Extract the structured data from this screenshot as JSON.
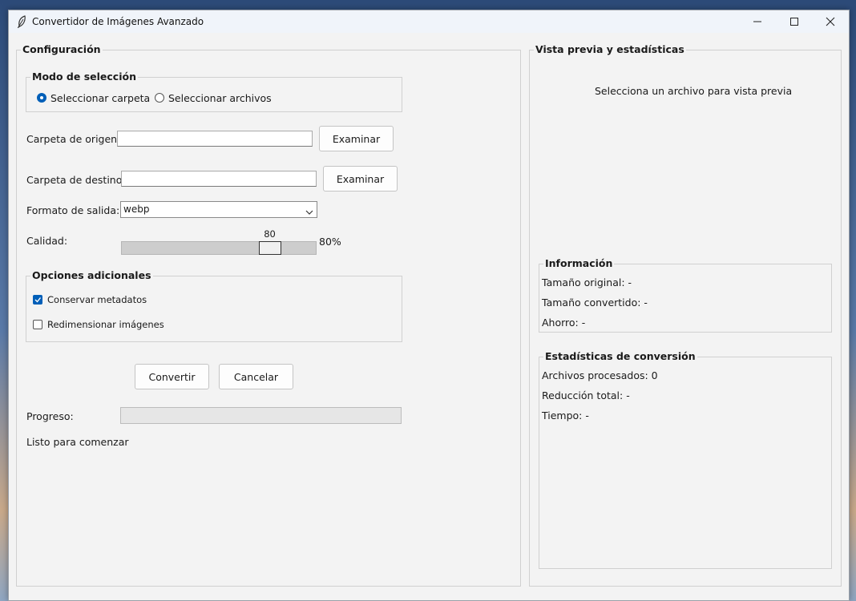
{
  "window": {
    "title": "Convertidor de Imágenes Avanzado",
    "icon": "feather-icon"
  },
  "config": {
    "frame_title": "Configuración",
    "mode": {
      "title": "Modo de selección",
      "options": [
        {
          "label": "Seleccionar carpeta",
          "selected": true
        },
        {
          "label": "Seleccionar archivos",
          "selected": false
        }
      ]
    },
    "origin": {
      "label": "Carpeta de origen:",
      "value": "",
      "browse_label": "Examinar"
    },
    "dest": {
      "label": "Carpeta de destino:",
      "value": "",
      "browse_label": "Examinar"
    },
    "format": {
      "label": "Formato de salida:",
      "value": "webp"
    },
    "quality": {
      "label": "Calidad:",
      "value": 80,
      "value_text": "80",
      "percent_text": "80%",
      "min": 0,
      "max": 100
    },
    "extra": {
      "title": "Opciones adicionales",
      "options": [
        {
          "label": "Conservar metadatos",
          "checked": true
        },
        {
          "label": "Redimensionar imágenes",
          "checked": false
        }
      ]
    },
    "convert_label": "Convertir",
    "cancel_label": "Cancelar",
    "progress": {
      "label": "Progreso:",
      "value": 0
    },
    "status": "Listo para comenzar"
  },
  "preview": {
    "frame_title": "Vista previa y estadísticas",
    "placeholder": "Selecciona un archivo para vista previa",
    "info": {
      "title": "Información",
      "lines": [
        "Tamaño original: -",
        "Tamaño convertido: -",
        "Ahorro: -"
      ]
    },
    "stats": {
      "title": "Estadísticas de conversión",
      "lines": [
        "Archivos procesados: 0",
        "Reducción total: -",
        "Tiempo: -"
      ]
    }
  },
  "colors": {
    "accent": "#005fb8",
    "window_bg": "#f3f3f3"
  }
}
